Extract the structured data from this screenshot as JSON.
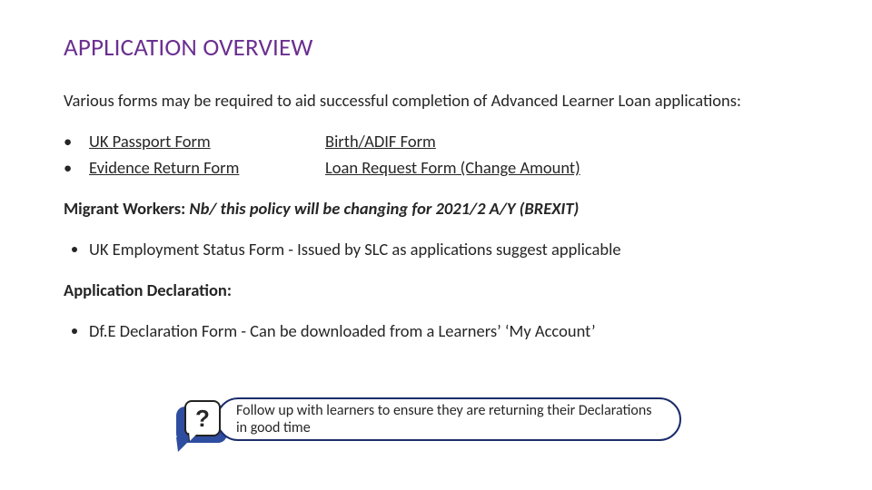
{
  "title": "APPLICATION OVERVIEW",
  "intro": "Various forms may be required to aid successful completion of Advanced Learner Loan applications:",
  "links": {
    "row1": {
      "left": "UK Passport Form",
      "right": "Birth/ADIF Form"
    },
    "row2": {
      "left": "Evidence Return Form",
      "right": "Loan Request Form (Change Amount)"
    }
  },
  "migrant": {
    "label": "Migrant Workers:",
    "note": "Nb/ this policy will be changing for 2021/2 A/Y (BREXIT)"
  },
  "employment_item": "UK Employment Status Form - Issued by SLC as applications suggest  applicable",
  "declaration_heading": "Application Declaration:",
  "declaration_item": "Df.E Declaration Form - Can be downloaded from a Learners’ ‘My Account’",
  "callout": {
    "qmark": "?",
    "text": "Follow up with learners to ensure they are returning their Declarations in good time"
  },
  "bullet_glyph": "•"
}
